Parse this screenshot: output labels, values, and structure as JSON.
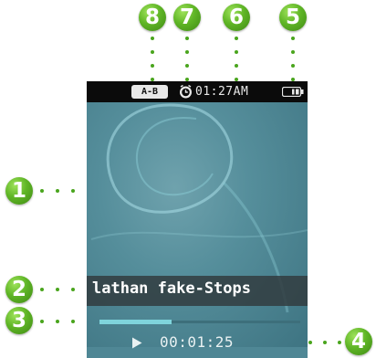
{
  "callouts": [
    {
      "number": "1",
      "target": "album art display"
    },
    {
      "number": "2",
      "target": "song title"
    },
    {
      "number": "3",
      "target": "progress bar"
    },
    {
      "number": "4",
      "target": "elapsed time"
    },
    {
      "number": "5",
      "target": "battery indicator"
    },
    {
      "number": "6",
      "target": "clock"
    },
    {
      "number": "7",
      "target": "alarm indicator"
    },
    {
      "number": "8",
      "target": "A-B repeat indicator"
    }
  ],
  "status_bar": {
    "ab_repeat_label": "A-B",
    "alarm_icon": "alarm-clock-icon",
    "clock": "01:27AM",
    "battery_icon": "battery-icon"
  },
  "now_playing": {
    "title": "lathan fake-Stops",
    "progress_fraction": 0.36,
    "play_icon": "play-icon",
    "elapsed": "00:01:25"
  },
  "colors": {
    "callout_green": "#5fb526",
    "screen_teal": "#4f8795",
    "progress_fill": "#7fd4dc",
    "status_bar_bg": "#0b0b0b"
  }
}
